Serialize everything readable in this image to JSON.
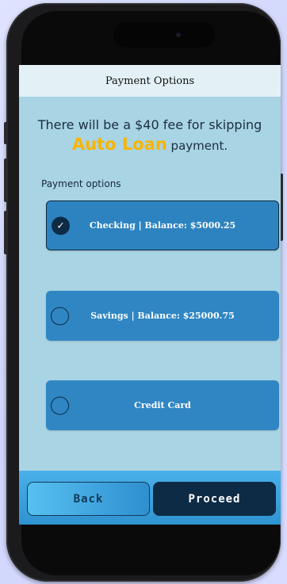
{
  "header": {
    "title": "Payment Options"
  },
  "fee_notice": {
    "line1": "There will be a $40 fee for skipping",
    "highlight": "Auto Loan",
    "line2_suffix": " payment."
  },
  "options_title": "Payment options",
  "options": [
    {
      "label": "Checking  | Balance: $5000.25",
      "selected": true
    },
    {
      "label": "Savings  | Balance: $25000.75",
      "selected": false
    },
    {
      "label": "Credit Card",
      "selected": false
    }
  ],
  "buttons": {
    "back": "Back",
    "proceed": "Proceed"
  },
  "colors": {
    "highlight": "#f7b500",
    "option_bg": "#2f86c3",
    "primary_dark": "#0d2b45",
    "app_bg": "#a9d4e3"
  },
  "icons": {
    "selected": "check-icon"
  }
}
